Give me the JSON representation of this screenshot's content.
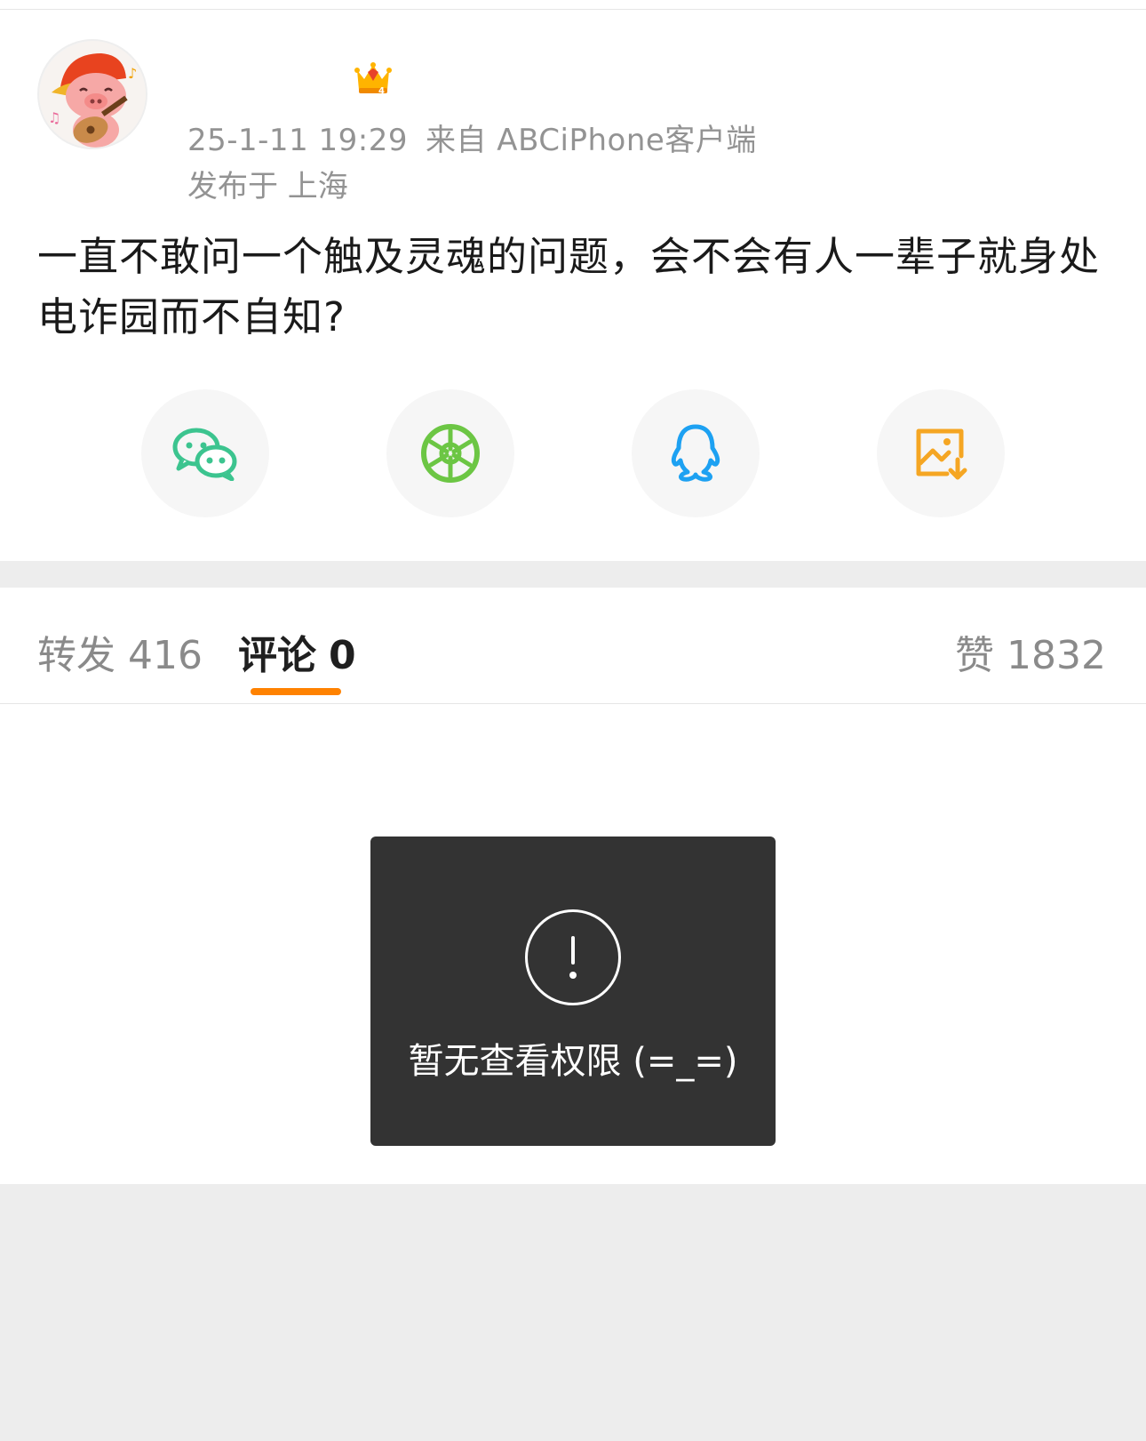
{
  "post": {
    "avatar_icon": "pig-with-guitar-avatar",
    "badge_icon": "crown-icon",
    "timestamp": "25-1-11 19:29",
    "source": "来自 ABCiPhone客户端",
    "location": "发布于 上海",
    "text": "一直不敢问一个触及灵魂的问题，会不会有人一辈子就身处电诈园而不自知?"
  },
  "share": {
    "items": [
      {
        "icon": "wechat-icon",
        "color": "#3cc48f"
      },
      {
        "icon": "moments-icon",
        "color": "#6cc644"
      },
      {
        "icon": "qq-icon",
        "color": "#1da1f2"
      },
      {
        "icon": "save-image-icon",
        "color": "#f5a623"
      }
    ]
  },
  "tabs": {
    "repost_label": "转发",
    "repost_count": "416",
    "comment_label": "评论",
    "comment_count": "0",
    "like_label": "赞",
    "like_count": "1832",
    "accent": "#ff8200"
  },
  "toast": {
    "icon": "exclamation-icon",
    "message": "暂无查看权限 (=_=)"
  }
}
